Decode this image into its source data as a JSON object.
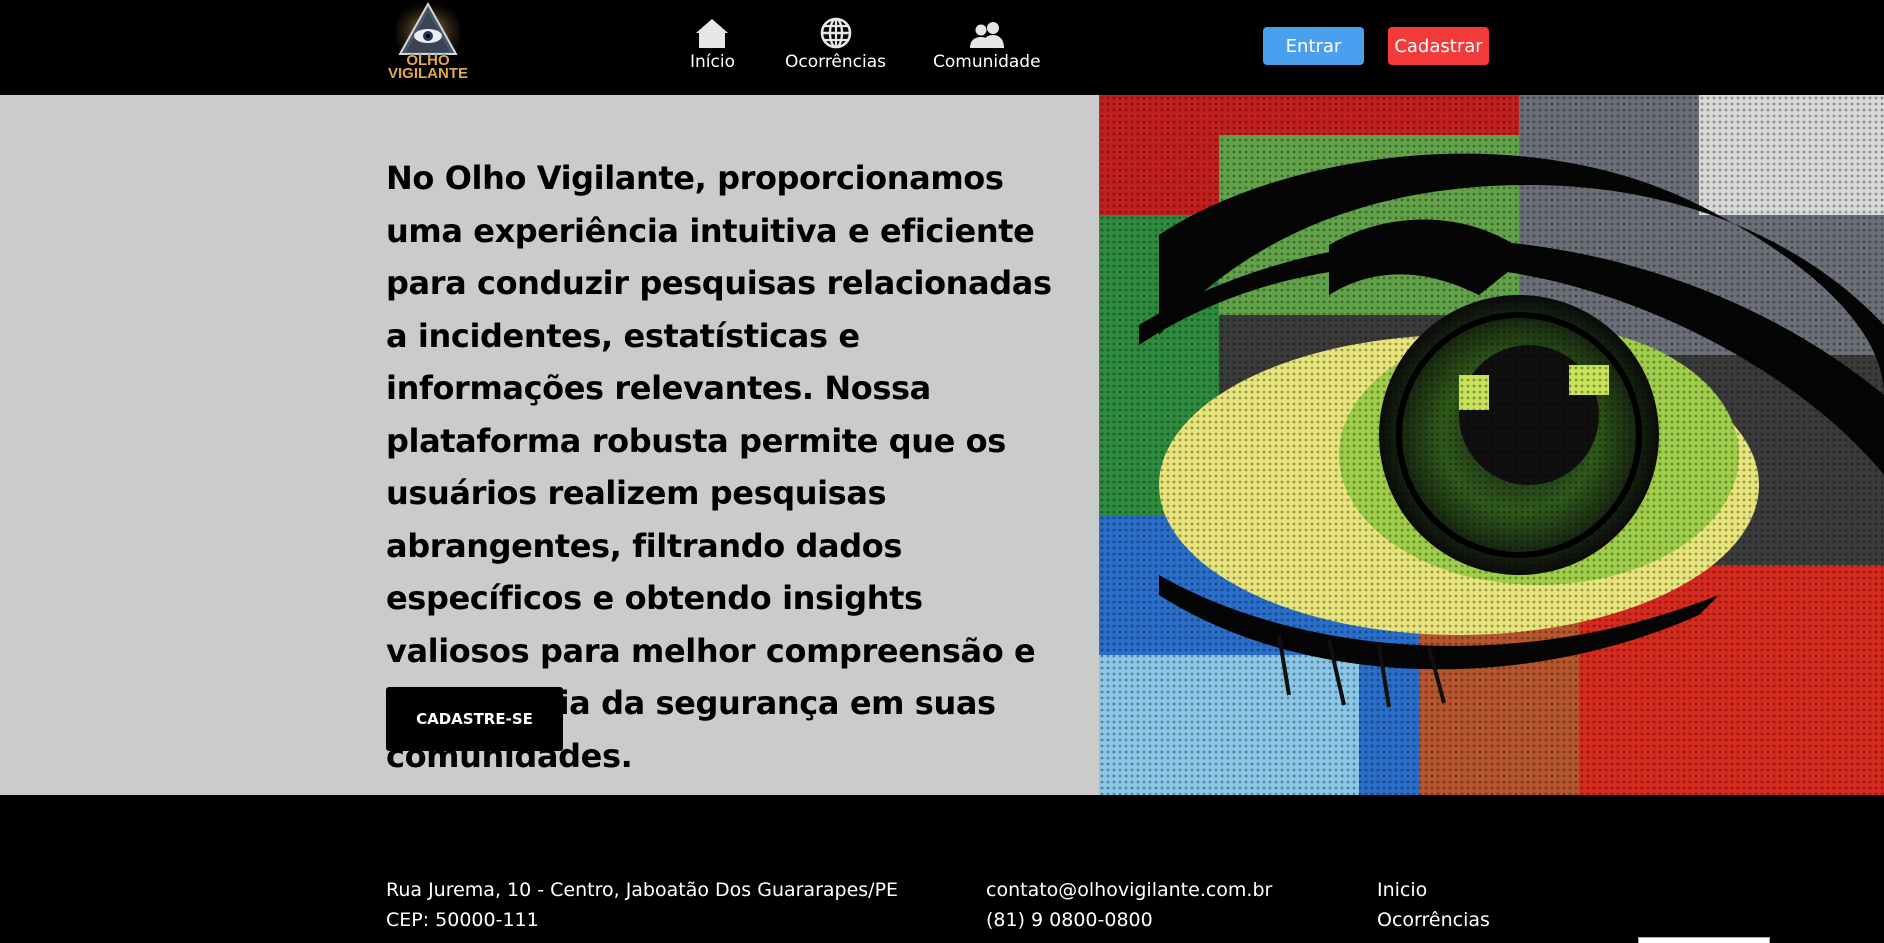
{
  "brand": {
    "logo_line1": "OLHO",
    "logo_line2": "VIGILANTE"
  },
  "nav": {
    "items": [
      {
        "label": "Início",
        "icon": "home-icon"
      },
      {
        "label": "Ocorrências",
        "icon": "globe-icon"
      },
      {
        "label": "Comunidade",
        "icon": "users-icon"
      }
    ]
  },
  "auth": {
    "login_label": "Entrar",
    "signup_label": "Cadastrar"
  },
  "hero": {
    "text": "No Olho Vigilante, proporcionamos uma experiência intuitiva e eficiente para conduzir pesquisas relacionadas a incidentes, estatísticas e informações relevantes. Nossa plataforma robusta permite que os usuários realizem pesquisas abrangentes, filtrando dados específicos e obtendo insights valiosos para melhor compreensão e consciência da segurança em suas comunidades.",
    "cta_label": "CADASTRE-SE",
    "image_icon": "colorful-eye-image"
  },
  "footer": {
    "address_line1": "Rua Jurema, 10 - Centro, Jaboatão Dos Guararapes/PE",
    "address_line2": "CEP: 50000-111",
    "email": "contato@olhovigilante.com.br",
    "phone": "(81) 9 0800-0800",
    "links": [
      "Inicio",
      "Ocorrências"
    ]
  },
  "colors": {
    "header_bg": "#000000",
    "hero_bg": "#cbcbcb",
    "login_button": "#4a9fee",
    "signup_button": "#f23a3a",
    "logo_text": "#e0a84a"
  }
}
